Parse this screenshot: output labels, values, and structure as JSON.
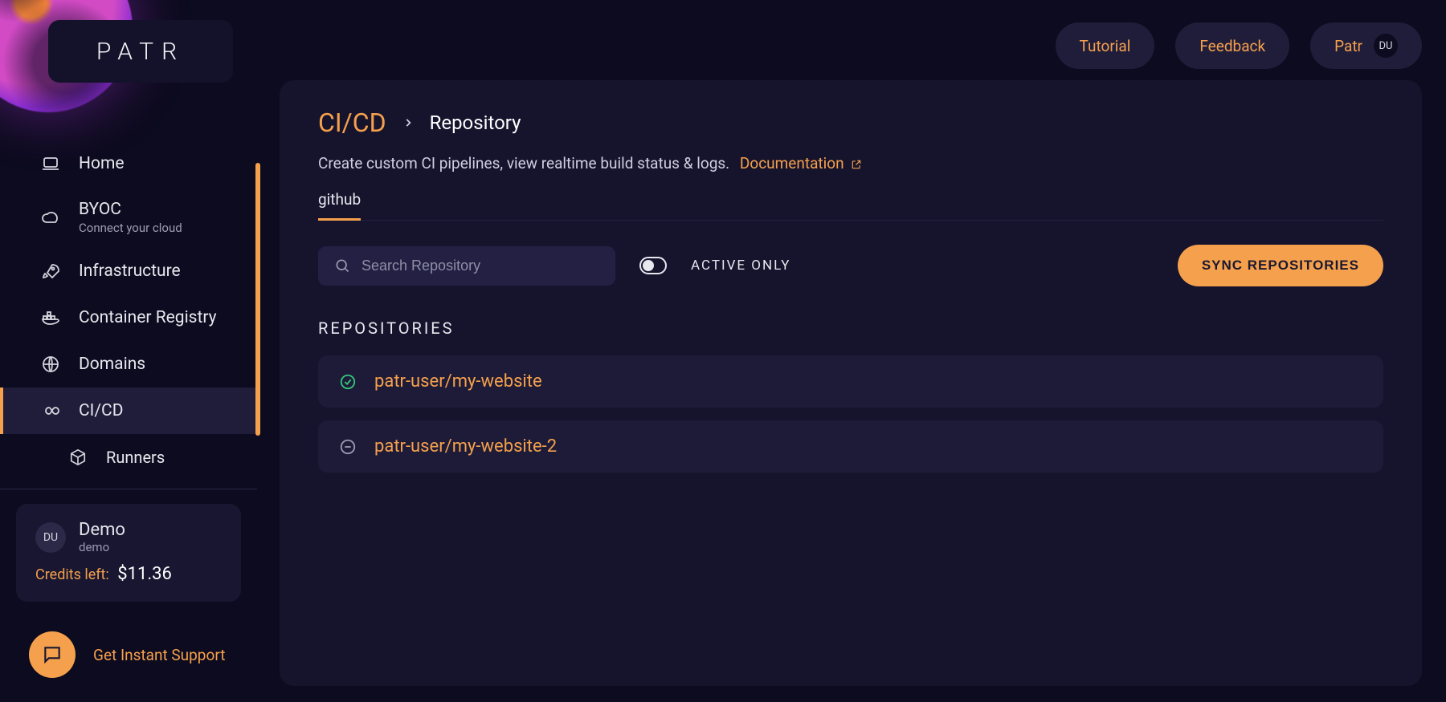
{
  "brand": "PATR",
  "header": {
    "tutorial": "Tutorial",
    "feedback": "Feedback",
    "workspace_short": "Patr",
    "avatar_initials": "DU"
  },
  "sidebar": {
    "items": [
      {
        "label": "Home"
      },
      {
        "label": "BYOC",
        "sub": "Connect your cloud"
      },
      {
        "label": "Infrastructure"
      },
      {
        "label": "Container Registry"
      },
      {
        "label": "Domains"
      },
      {
        "label": "CI/CD"
      },
      {
        "label": "Runners"
      }
    ]
  },
  "workspace": {
    "avatar_initials": "DU",
    "name": "Demo",
    "handle": "demo",
    "credits_label": "Credits left:",
    "credits_amount": "$11.36"
  },
  "support": {
    "label": "Get Instant Support"
  },
  "breadcrumb": {
    "root": "CI/CD",
    "leaf": "Repository"
  },
  "subtitle": "Create custom CI pipelines, view realtime build status & logs.",
  "doc_link": "Documentation",
  "tabs": [
    {
      "label": "github"
    }
  ],
  "search": {
    "placeholder": "Search Repository"
  },
  "active_only_label": "ACTIVE ONLY",
  "sync_button": "SYNC REPOSITORIES",
  "section_title": "REPOSITORIES",
  "repos": [
    {
      "name": "patr-user/my-website",
      "status": "active"
    },
    {
      "name": "patr-user/my-website-2",
      "status": "inactive"
    }
  ]
}
